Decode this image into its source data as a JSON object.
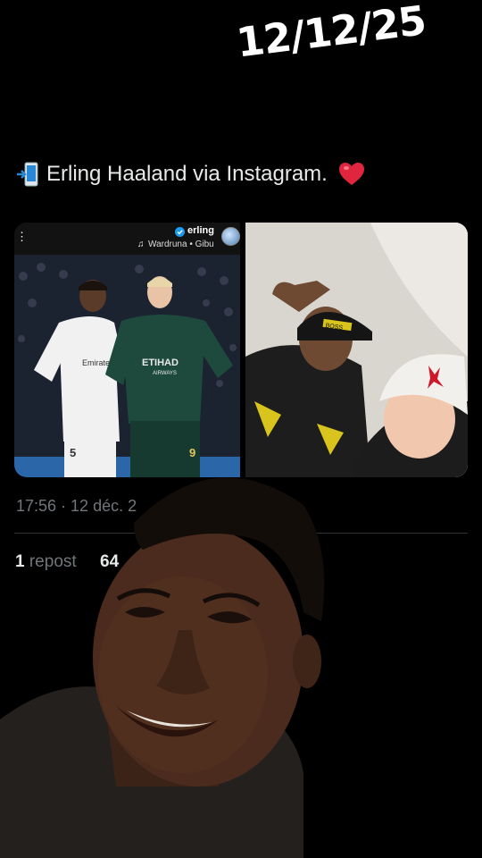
{
  "overlay": {
    "date": "12/12/25"
  },
  "tweet": {
    "text": "Erling Haaland via Instagram.",
    "media": {
      "left": {
        "username": "erling",
        "music": "Wardruna • Gibu",
        "menu_glyph": "⋮",
        "music_glyph": "♫",
        "jersey_number_left": "5",
        "jersey_number_right": "9",
        "sponsor_left": "Emirates",
        "sponsor_right": "ETIHAD",
        "sponsor_right_sub": "AIRWAYS"
      },
      "right": {
        "cap_text": "BOSS",
        "hat_logo": "jumpman-logo"
      }
    },
    "timestamp": "17:56 · 12 déc. 2",
    "reposts_count": "1",
    "reposts_label": "repost",
    "likes_count": "64"
  },
  "colors": {
    "background": "#000000",
    "text": "#e7e9ea",
    "muted": "#71767b",
    "heart": "#f91880",
    "verified": "#1d9bf0"
  }
}
